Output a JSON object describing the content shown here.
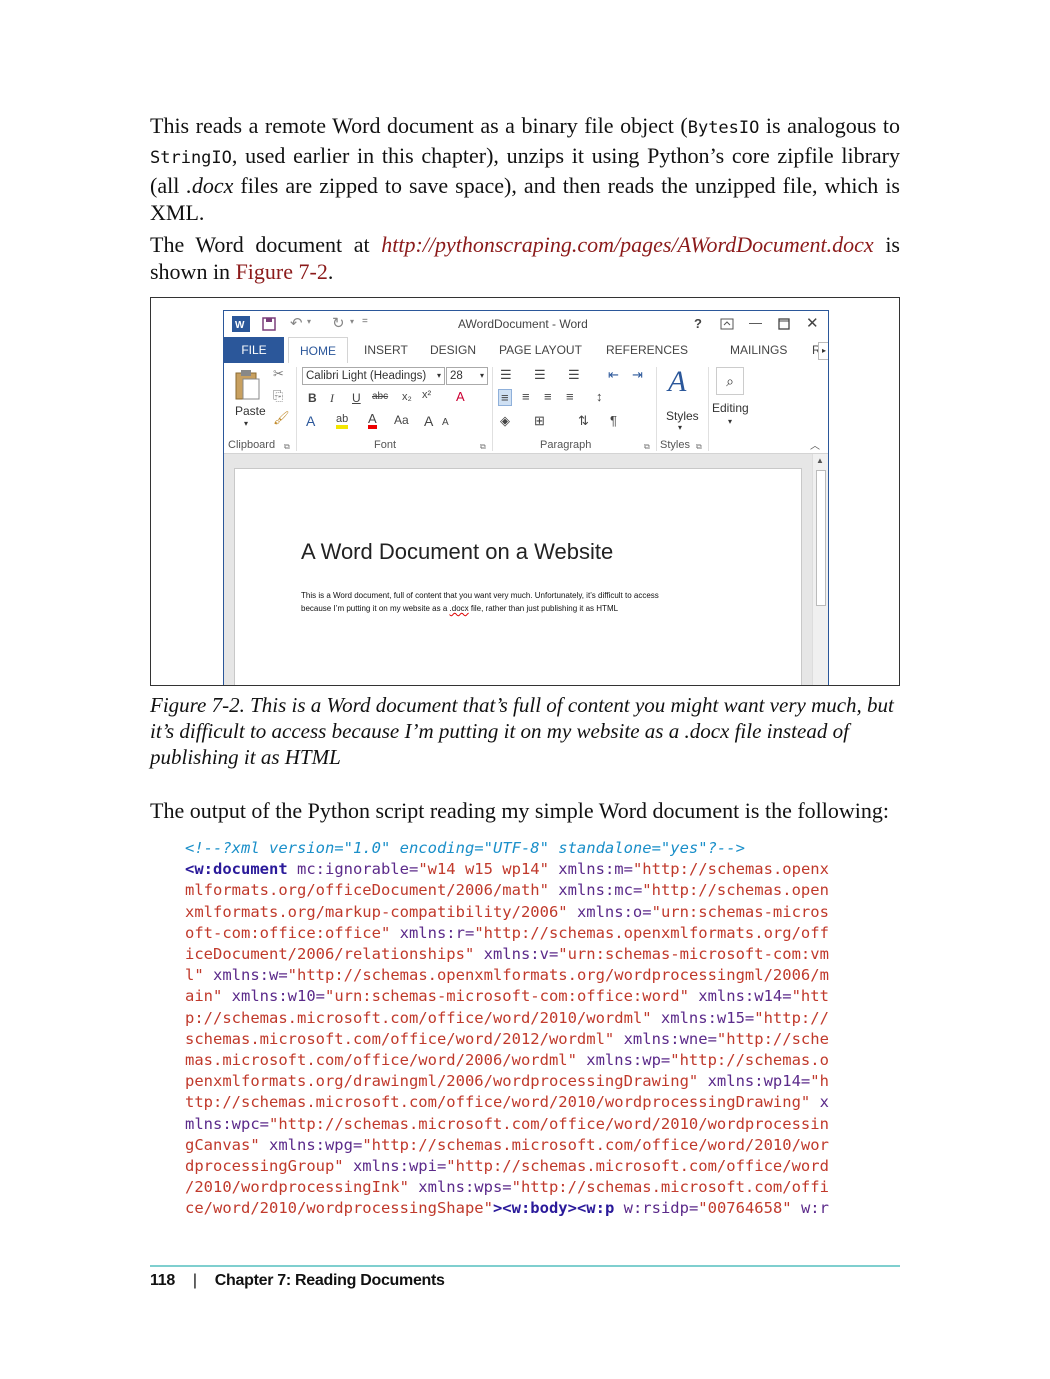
{
  "para1": {
    "t1": "This reads a remote Word document as a binary file object (",
    "code1": "BytesIO",
    "t2": " is analogous to ",
    "code2": "StringIO",
    "t3": ", used earlier in this chapter), unzips it using Python’s core zipfile library (all ",
    "ital": ".docx",
    "t4": " files are zipped to save space), and then reads the unzipped file, which is XML."
  },
  "para2": {
    "t1": "The Word document at ",
    "url": "http://pythonscraping.com/pages/AWordDocument.docx",
    "t2": " is shown in ",
    "figref": "Figure 7-2",
    "t3": "."
  },
  "word": {
    "title": "AWordDocument - Word",
    "help": "?",
    "tabs": [
      "FILE",
      "HOME",
      "INSERT",
      "DESIGN",
      "PAGE LAYOUT",
      "REFERENCES",
      "MAILINGS",
      "REVIE"
    ],
    "font_name": "Calibri Light (Headings)",
    "font_size": "28",
    "groups": [
      "Clipboard",
      "Font",
      "Paragraph",
      "Styles"
    ],
    "paste_label": "Paste",
    "styles_label": "Styles",
    "editing_label": "Editing",
    "doc_heading": "A Word Document on a Website",
    "doc_body_1": "This is a Word document, full of content that you want very much. Unfortunately, it’s difficult to access",
    "doc_body_2a": "because I’m putting it on my website as a ",
    "doc_body_2b": ".docx",
    "doc_body_2c": " file, rather than just publishing it as HTML"
  },
  "caption": "Figure 7-2. This is a Word document that’s full of content you might want very much, but it’s difficult to access because I’m putting it on my website as a .docx file instead of publishing it as HTML",
  "para3": "The output of the Python script reading my simple Word document is the following:",
  "code_lines": [
    "<!--?xml version=\"1.0\" encoding=\"UTF-8\" standalone=\"yes\"?-->",
    "<w:document mc:ignorable=\"w14 w15 wp14\" xmlns:m=\"http://schemas.openx",
    "mlformats.org/officeDocument/2006/math\" xmlns:mc=\"http://schemas.open",
    "xmlformats.org/markup-compatibility/2006\" xmlns:o=\"urn:schemas-micros",
    "oft-com:office:office\" xmlns:r=\"http://schemas.openxmlformats.org/off",
    "iceDocument/2006/relationships\" xmlns:v=\"urn:schemas-microsoft-com:vm",
    "l\" xmlns:w=\"http://schemas.openxmlformats.org/wordprocessingml/2006/m",
    "ain\" xmlns:w10=\"urn:schemas-microsoft-com:office:word\" xmlns:w14=\"htt",
    "p://schemas.microsoft.com/office/word/2010/wordml\" xmlns:w15=\"http://",
    "schemas.microsoft.com/office/word/2012/wordml\" xmlns:wne=\"http://sche",
    "mas.microsoft.com/office/word/2006/wordml\" xmlns:wp=\"http://schemas.o",
    "penxmlformats.org/drawingml/2006/wordprocessingDrawing\" xmlns:wp14=\"h",
    "ttp://schemas.microsoft.com/office/word/2010/wordprocessingDrawing\" x",
    "mlns:wpc=\"http://schemas.microsoft.com/office/word/2010/wordprocessin",
    "gCanvas\" xmlns:wpg=\"http://schemas.microsoft.com/office/word/2010/wor",
    "dprocessingGroup\" xmlns:wpi=\"http://schemas.microsoft.com/office/word",
    "/2010/wordprocessingInk\" xmlns:wps=\"http://schemas.microsoft.com/offi",
    "ce/word/2010/wordprocessingShape\"><w:body><w:p w:rsidp=\"00764658\" w:r"
  ],
  "footer": {
    "page": "118",
    "sep": "|",
    "chapter": "Chapter 7: Reading Documents"
  }
}
